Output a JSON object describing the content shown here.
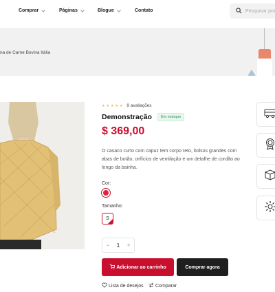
{
  "nav": {
    "items": [
      {
        "label": "Comprar",
        "has_dropdown": true
      },
      {
        "label": "Páginas",
        "has_dropdown": true
      },
      {
        "label": "Blogue",
        "has_dropdown": true
      },
      {
        "label": "Contato",
        "has_dropdown": false
      }
    ],
    "search": {
      "placeholder": "Pesquisar produtos",
      "icon": "search-icon"
    }
  },
  "banner": {
    "breadcrumb": "na de Carne Bovina Itália"
  },
  "product": {
    "rating_stars": 5,
    "reviews": "9 avaliações",
    "title": "Demonstração",
    "stock_badge": "Em estoque",
    "price": "$ 369,00",
    "description": "O casaco curto com capuz tem corpo reto, bolsos grandes com abas de botão, orifícios de ventilação e um detalhe de cordão ao longo da bainha.",
    "color_label": "Cor:",
    "color_value": "#d9263e",
    "size_label": "Tamanho:",
    "size_value": "S",
    "quantity": "1",
    "qty_minus": "−",
    "qty_plus": "+",
    "add_to_cart": "Adicionar ao carrinho",
    "buy_now": "Comprar agora",
    "wishlist": "Lista de desejos",
    "compare": "Comparar"
  },
  "features": [
    "truck-icon",
    "award-icon",
    "box-return-icon",
    "gear-icon"
  ],
  "colors": {
    "accent": "#c8102e",
    "dark": "#1f1f1f",
    "banner_bg": "#f1f1f1",
    "star": "#f0b54a"
  }
}
